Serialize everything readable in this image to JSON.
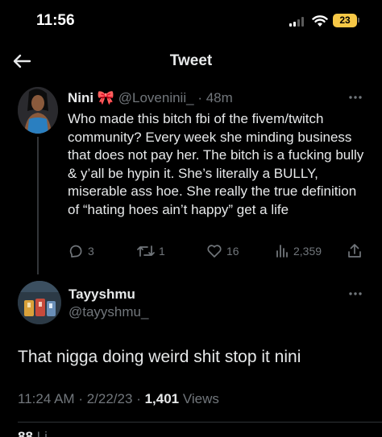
{
  "status_bar": {
    "time": "11:56",
    "battery": "23",
    "battery_color": "#f7c846"
  },
  "header": {
    "title": "Tweet",
    "back_icon": "arrow-left-icon"
  },
  "parent_tweet": {
    "author_name": "Nini",
    "emoji": "🎀",
    "handle": "@Loveninii_",
    "separator": "·",
    "age": "48m",
    "text": "Who made this bitch fbi of the fivem/twitch community? Every week she minding business that does not pay her. The bitch is a fucking bully & y’all be hypin it. She’s literally a BULLY, miserable ass hoe. She really the true definition of “hating hoes ain’t happy” get a life",
    "replies": "3",
    "retweets": "1",
    "likes": "16",
    "views": "2,359"
  },
  "reply": {
    "author_name": "Tayyshmu",
    "handle": "@tayyshmu_",
    "text": "That nigga doing weird shit stop it nini",
    "time": "11:24 AM",
    "date": "2/22/23",
    "dot": "·",
    "views_count": "1,401",
    "views_label": "Views",
    "likes_partial_count": "88",
    "likes_partial_label": "Li"
  },
  "colors": {
    "background": "#000000",
    "text": "#e7e9ea",
    "muted": "#71767b",
    "divider": "#2f3336"
  }
}
